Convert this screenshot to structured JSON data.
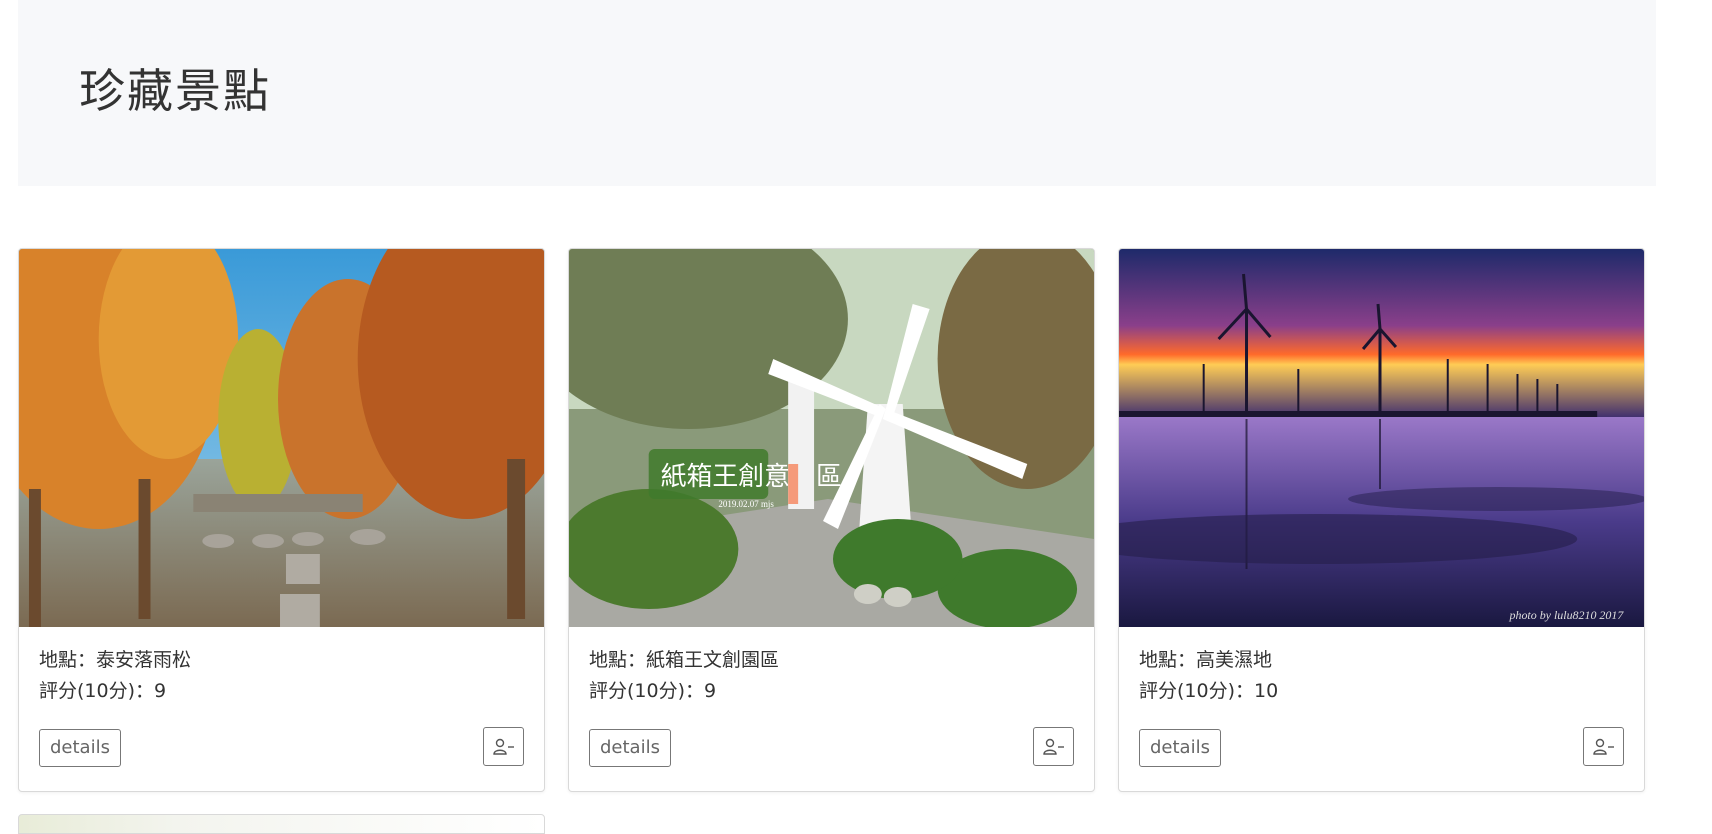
{
  "header": {
    "title": "珍藏景點"
  },
  "cards": [
    {
      "location": "地點：泰安落雨松",
      "rating": "評分(10分)：9",
      "details_label": "details",
      "image": "autumn-cypress-forest-photo",
      "user_icon": "person-minus-icon"
    },
    {
      "location": "地點：紙箱王文創園區",
      "rating": "評分(10分)：9",
      "details_label": "details",
      "image": "windmill-park-photo",
      "image_caption_title": "紙箱王創意園區",
      "image_caption_date": "2019.02.07 mjs",
      "user_icon": "person-minus-icon"
    },
    {
      "location": "地點：高美濕地",
      "rating": "評分(10分)：10",
      "details_label": "details",
      "image": "wetland-wind-turbines-sunset-photo",
      "image_watermark": "photo by lulu8210 2017",
      "user_icon": "person-minus-icon"
    }
  ]
}
